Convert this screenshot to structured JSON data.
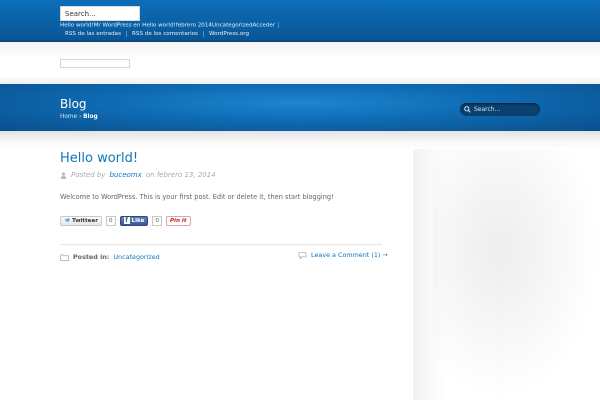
{
  "topbar": {
    "search_value": "Search...",
    "recent_items": [
      "Hello world!",
      "Mr WordPress en Hello world!",
      "febrero 2014",
      "Uncategorized",
      "Acceder"
    ],
    "meta_links": [
      "RSS de las entradas",
      "RSS de los comentarios",
      "WordPress.org"
    ]
  },
  "banner": {
    "title": "Blog",
    "breadcrumb_home": "Home",
    "breadcrumb_separator": "›",
    "breadcrumb_current": "Blog",
    "search_placeholder": "Search..."
  },
  "post": {
    "title": "Hello world!",
    "posted_by": "Posted by",
    "author": "buceomx",
    "on_date": "on febrero 13, 2014",
    "body": "Welcome to WordPress. This is your first post. Edit or delete it, then start blogging!",
    "share": {
      "twitter_label": "Twittear",
      "twitter_count": "0",
      "facebook_label": "Like",
      "facebook_count": "0",
      "pinterest_label": "Pin it"
    },
    "posted_in_label": "Posted in:",
    "category": "Uncategorized",
    "comments_link": "Leave a Comment (1) →"
  },
  "colors": {
    "brand_blue": "#0f75bc",
    "topbar_blue": "#0a5fa3",
    "banner_blue": "#0e6bb3"
  }
}
